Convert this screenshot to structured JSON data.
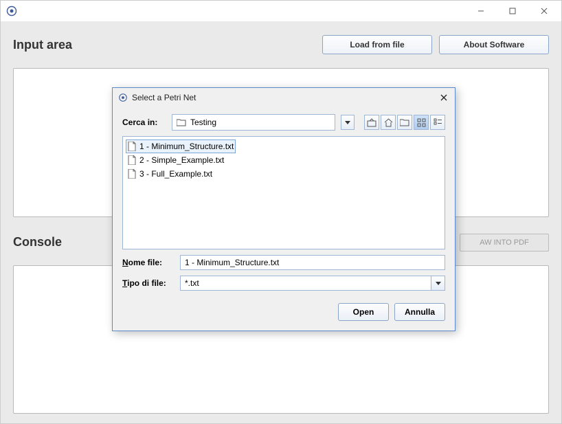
{
  "window": {
    "title": ""
  },
  "main": {
    "input_title": "Input area",
    "load_btn": "Load from file",
    "about_btn": "About Software",
    "console_title": "Console",
    "pdf_btn": "AW INTO PDF"
  },
  "dialog": {
    "title": "Select a Petri Net",
    "look_in_label": "Cerca in:",
    "folder_name": "Testing",
    "files": [
      "1 - Minimum_Structure.txt",
      "2 - Simple_Example.txt",
      "3 - Full_Example.txt"
    ],
    "filename_label": "Nome file:",
    "filename_value": "1 - Minimum_Structure.txt",
    "filetype_label": "Tipo di file:",
    "filetype_value": "*.txt",
    "open_btn": "Open",
    "cancel_btn": "Annulla"
  }
}
